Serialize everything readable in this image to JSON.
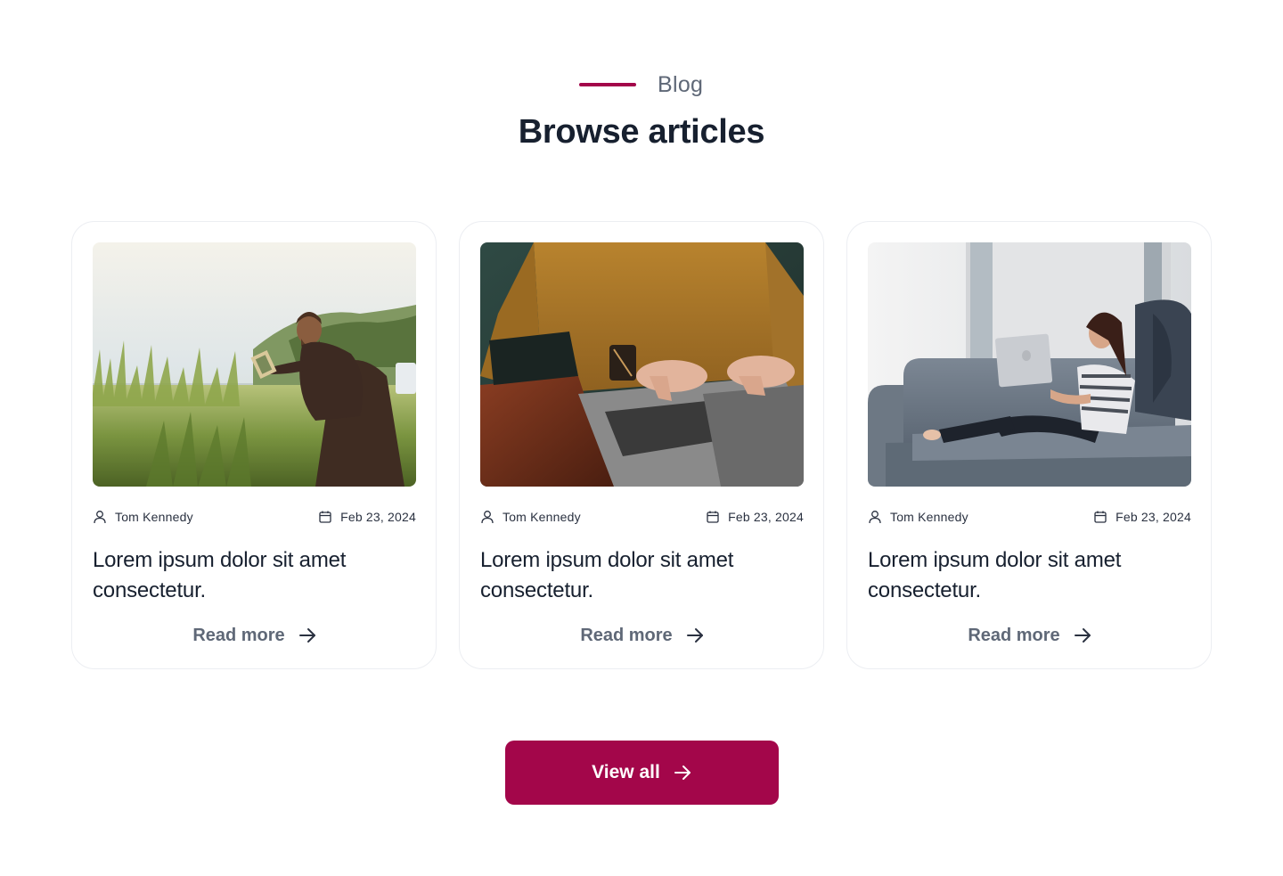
{
  "header": {
    "eyebrow": "Blog",
    "title": "Browse articles",
    "accent_color": "#a3064a"
  },
  "articles": [
    {
      "author": "Tom Kennedy",
      "date": "Feb 23, 2024",
      "title": "Lorem ipsum dolor sit amet consectetur.",
      "read_more": "Read more",
      "image": "man-reading-book-in-tall-grass"
    },
    {
      "author": "Tom Kennedy",
      "date": "Feb 23, 2024",
      "title": "Lorem ipsum dolor sit amet consectetur.",
      "read_more": "Read more",
      "image": "hands-typing-on-laptop-in-mustard-sweater"
    },
    {
      "author": "Tom Kennedy",
      "date": "Feb 23, 2024",
      "title": "Lorem ipsum dolor sit amet consectetur.",
      "read_more": "Read more",
      "image": "woman-with-laptop-on-grey-sofa"
    }
  ],
  "cta": {
    "label": "View all",
    "color": "#a3064a"
  }
}
